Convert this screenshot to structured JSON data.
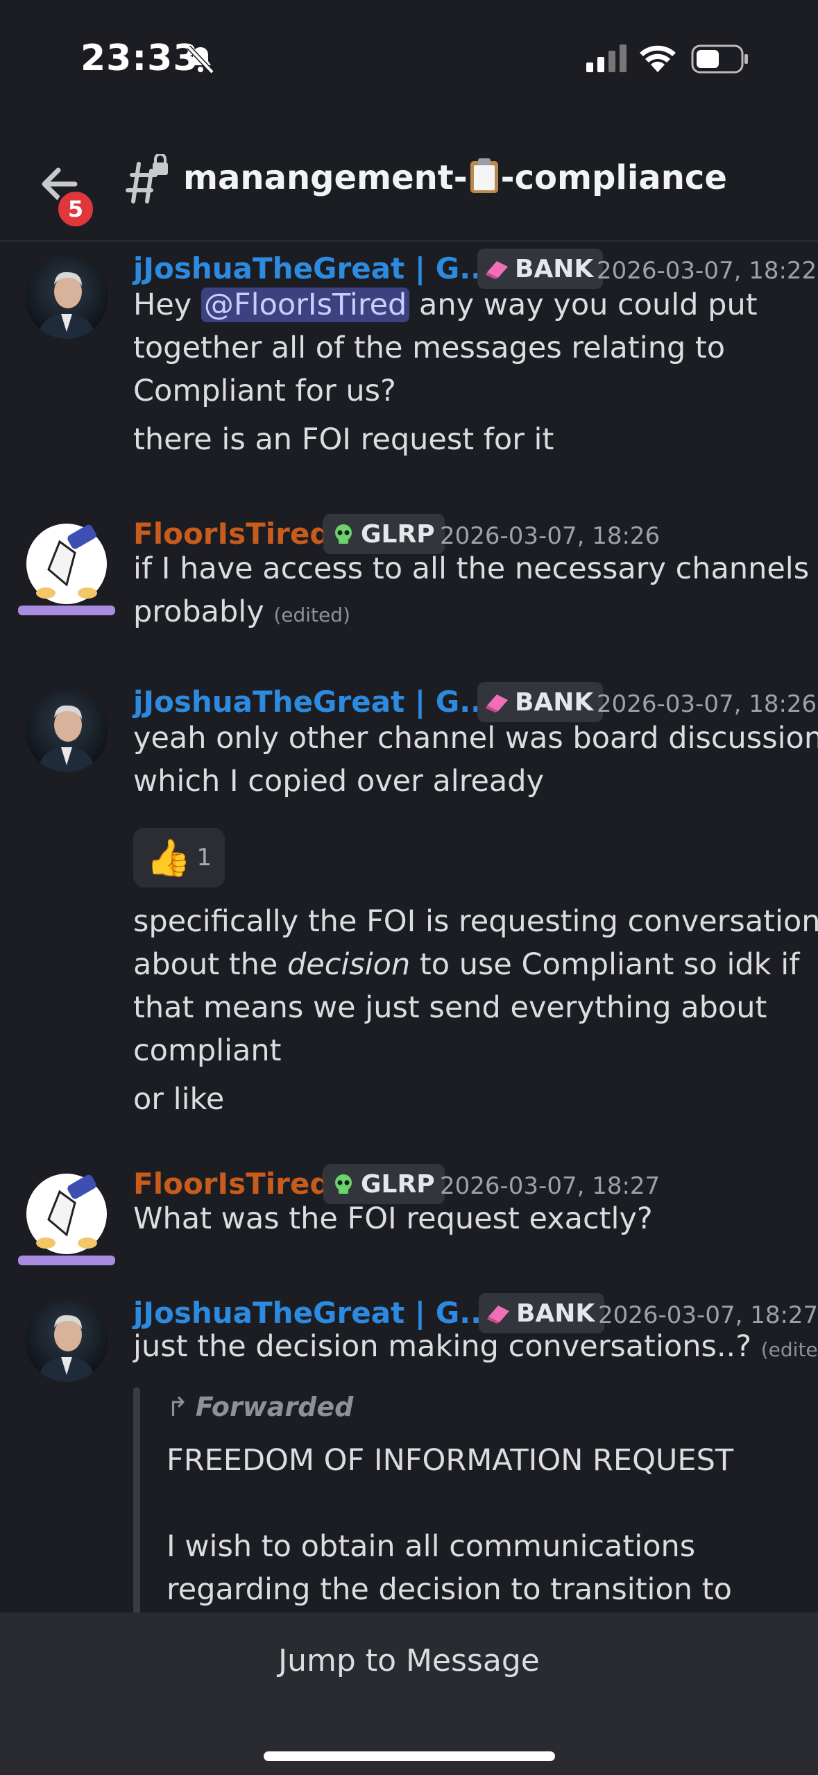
{
  "status_bar": {
    "time": "23:33",
    "icons": [
      "bell-slash-icon",
      "signal-icon",
      "wifi-icon",
      "battery-icon"
    ]
  },
  "header": {
    "badge_count": "5",
    "channel_prefix": "manangement-",
    "channel_suffix": "-compliance",
    "channel_emoji": "clipboard-icon"
  },
  "messages": [
    {
      "author": "jJoshuaTheGreat | G...",
      "tag": "BANK",
      "timestamp": "2026-03-07, 18:22",
      "line1_pre": "Hey ",
      "mention": "@FloorIsTired",
      "line1_post": " any way you could put",
      "line2": "together all of the messages relating to",
      "line3": "Compliant for us?",
      "line4": "there is an FOI request for it"
    },
    {
      "author": "FloorIsTired",
      "tag": "GLRP",
      "timestamp": "2026-03-07, 18:26",
      "line1": "if I have access to all the necessary channels",
      "line2": "probably",
      "edited": "(edited)"
    },
    {
      "author": "jJoshuaTheGreat | G...",
      "tag": "BANK",
      "timestamp": "2026-03-07, 18:26",
      "line1": "yeah only other channel was board discussion",
      "line2": "which I copied over already",
      "reaction": {
        "emoji": "👍",
        "count": "1"
      },
      "line3": "specifically the FOI is requesting conversation",
      "line4_pre": "about the ",
      "line4_em": "decision",
      "line4_post": " to use Compliant so idk if",
      "line5": "that means we just send everything about",
      "line6": "compliant",
      "line7": "or like"
    },
    {
      "author": "FloorIsTired",
      "tag": "GLRP",
      "timestamp": "2026-03-07, 18:27",
      "line1": "What was the FOI request exactly?"
    },
    {
      "author": "jJoshuaTheGreat | G...",
      "tag": "BANK",
      "timestamp": "2026-03-07, 18:27",
      "line1": "just the decision making conversations..?",
      "edited": "(edited)",
      "forwarded_label": "Forwarded",
      "fwd1": "FREEDOM OF INFORMATION REQUEST",
      "fwd2": "I wish to obtain all communications",
      "fwd3": "regarding the decision to transition to"
    }
  ],
  "footer": {
    "jump_label": "Jump to Message"
  },
  "colors": {
    "background": "#1c1d22",
    "blue_name": "#2c8be0",
    "orange_name": "#c85c1c",
    "mention_bg": "#3c4280"
  }
}
